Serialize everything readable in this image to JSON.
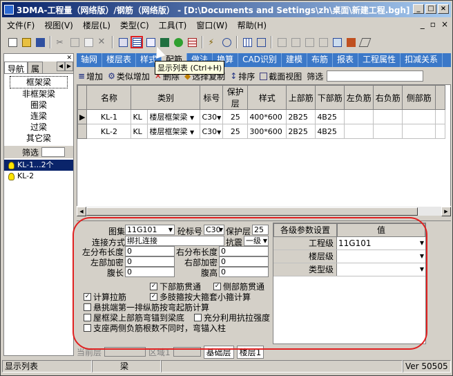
{
  "title": "3DMA-工程量（网络版）/钢筋（网络版） - [D:\\Documents and Settings\\zh\\桌面\\新建工程.bgh]",
  "menu": [
    "文件(F)",
    "视图(V)",
    "楼层(L)",
    "类型(C)",
    "工具(T)",
    "窗口(W)",
    "帮助(H)"
  ],
  "tooltip": "显示列表 (Ctrl+H)",
  "nav": {
    "tabs": [
      "导航",
      "属"
    ],
    "items": [
      "框架梁",
      "非框架梁",
      "圈梁",
      "连梁",
      "过梁",
      "其它梁"
    ],
    "filter_label": "筛选",
    "tree": [
      "KL-1...2个",
      "KL-2"
    ]
  },
  "tabs": [
    "轴网",
    "楼层表",
    "样式",
    "配筋",
    "做法",
    "换算",
    "CAD识别",
    "建模",
    "布筋",
    "报表",
    "工程属性",
    "扣减关系"
  ],
  "gridtb": {
    "add": "增加",
    "similar": "类似增加",
    "del": "删除",
    "copy": "选择复制",
    "sort": "排序",
    "section": "截面视图",
    "filter": "筛选"
  },
  "columns": [
    "名称",
    "类别",
    "",
    "标号",
    "保护层",
    "样式",
    "上部筋",
    "下部筋",
    "左负筋",
    "右负筋",
    "侧部筋"
  ],
  "rows": [
    {
      "name": "KL-1",
      "cat": "KL",
      "type": "楼层框架梁",
      "grade": "C30",
      "cover": "25",
      "size": "400*600",
      "top": "2B25",
      "bot": "4B25"
    },
    {
      "name": "KL-2",
      "cat": "KL",
      "type": "楼层框架梁",
      "grade": "C30",
      "cover": "25",
      "size": "300*600",
      "top": "2B25",
      "bot": "4B25"
    }
  ],
  "props": {
    "atlas_label": "图集",
    "atlas": "11G101",
    "grade_label": "砼标号",
    "grade": "C30",
    "cover_label": "保护层",
    "cover": "25",
    "conn_label": "连接方式",
    "conn": "绑扎连接",
    "seismic_label": "抗震",
    "seismic": "一级",
    "lbl_l": "左分布长度",
    "lbl_r": "右分布长度",
    "lbl_ld": "左部加密",
    "lbl_rd": "右部加密",
    "lbl_wl": "腹长",
    "lbl_wh": "腹高",
    "v0": "0",
    "v1": "0",
    "v2": "0",
    "v3": "0",
    "v4": "0",
    "v5": "0",
    "cb": [
      "下部筋贯通",
      "侧部筋贯通",
      "计算拉筋",
      "多肢箍按大箍套小箍计算",
      "悬挑端第一排纵筋按弯起筋计算",
      "屋框梁上部筋弯锚到梁底",
      "充分利用抗拉强度",
      "支座两侧负筋根数不同时，弯锚入柱"
    ]
  },
  "ptable": {
    "h1": "各级参数设置",
    "h2": "值",
    "rows": [
      {
        "k": "工程级",
        "v": "11G101"
      },
      {
        "k": "楼层级",
        "v": ""
      },
      {
        "k": "类型级",
        "v": ""
      }
    ]
  },
  "btabs": {
    "floor": "当前层",
    "zone": "区域1",
    "t1": "基础层",
    "t2": "楼层1"
  },
  "status": {
    "s1": "显示列表",
    "s2": "梁",
    "ver": "Ver 50505"
  }
}
